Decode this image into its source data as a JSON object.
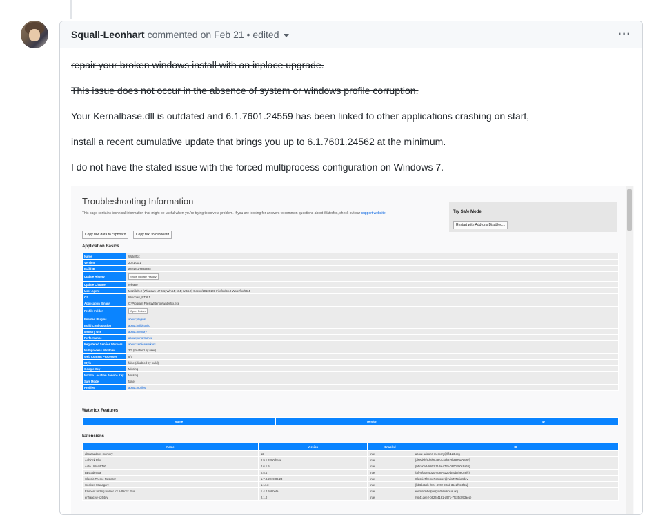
{
  "comment": {
    "author": "Squall-Leonhart",
    "action": "commented on",
    "date": "Feb 21",
    "separator": "•",
    "edited": "edited",
    "more": "···",
    "paragraphs": [
      {
        "text": "repair your broken windows install with an inplace upgrade.",
        "strike": true
      },
      {
        "text": "This issue does not occur in the absence of system or windows profile corruption.",
        "strike": true
      },
      {
        "text": "Your Kernalbase.dll is outdated and 6.1.7601.24559 has been linked to other applications crashing on start,",
        "strike": false
      },
      {
        "text": "install a recent cumulative update that brings you up to 6.1.7601.24562 at the minimum.",
        "strike": false
      },
      {
        "text": "I do not have the stated issue with the forced multiprocess configuration on Windows 7.",
        "strike": false
      }
    ]
  },
  "screenshot": {
    "title": "Troubleshooting Information",
    "desc": "This page contains technical information that might be useful when you're trying to solve a problem. If you are looking for answers to common questions about Waterfox, check out our",
    "desc_link": "support website.",
    "copy_raw": "Copy raw data to clipboard",
    "copy_text": "Copy text to clipboard",
    "safe_mode_title": "Try Safe Mode",
    "safe_mode_button": "Restart with Add-ons Disabled...",
    "app_basics_title": "Application Basics",
    "app_basics": [
      {
        "k": "Name",
        "v": "Waterfox"
      },
      {
        "k": "Version",
        "v": "2021.01.1"
      },
      {
        "k": "Build ID",
        "v": "20210127092903"
      },
      {
        "k": "Update History",
        "btn": "Show Update History"
      },
      {
        "k": "Update Channel",
        "v": "release"
      },
      {
        "k": "User Agent",
        "v": "Mozilla/5.0 (Windows NT 6.1; Win64; x64; rv:56.0) Gecko/20100101 Firefox/56.0 Waterfox/56.4"
      },
      {
        "k": "OS",
        "v": "Windows_NT 6.1"
      },
      {
        "k": "Application Binary",
        "v": "C:\\Program Files\\Waterfox\\waterfox.exe"
      },
      {
        "k": "Profile Folder",
        "btn": "Open Folder"
      },
      {
        "k": "Enabled Plugins",
        "link": "about:plugins"
      },
      {
        "k": "Build Configuration",
        "link": "about:buildconfig"
      },
      {
        "k": "Memory Use",
        "link": "about:memory"
      },
      {
        "k": "Performance",
        "link": "about:performance"
      },
      {
        "k": "Registered Service Workers",
        "link": "about:serviceworkers"
      },
      {
        "k": "Multiprocess Windows",
        "v": "2/2 (Enabled by user)"
      },
      {
        "k": "Web Content Processes",
        "v": "8/7"
      },
      {
        "k": "Stylo",
        "v": "false (disabled by build)"
      },
      {
        "k": "Google Key",
        "v": "Missing"
      },
      {
        "k": "Mozilla Location Service Key",
        "v": "Missing"
      },
      {
        "k": "Safe Mode",
        "v": "false"
      },
      {
        "k": "Profiles",
        "link": "about:profiles"
      }
    ],
    "features_title": "Waterfox Features",
    "features_cols": [
      "Name",
      "Version",
      "ID"
    ],
    "extensions_title": "Extensions",
    "extensions_cols": [
      "Name",
      "Version",
      "Enabled",
      "ID"
    ],
    "extensions": [
      [
        "aboutaddons-memory",
        "12",
        "true",
        "about-addons-memory@lfk123.org"
      ],
      [
        "Adblock Plus",
        "2.9.1.4200-beta",
        "true",
        "{d10d0bf8-f5b5-c8b4-a8b2-2b9879e08c5d}"
      ],
      [
        "Auto Unload Tab",
        "0.6.1.5",
        "true",
        "{b5cdcad-966d-11da-a72b-0800200c9a66}"
      ],
      [
        "BBCodeXtra",
        "0.5.4",
        "true",
        "{af79f008-4b20-4cae-822b-b5db7be028fc}"
      ],
      [
        "Classic Theme Restorer",
        "1.7.8.2019.06.23",
        "true",
        "ClassicThemeRestorer@ArisT2Noia4dev"
      ],
      [
        "Cookies Manager+",
        "1.14.3",
        "true",
        "{bb6bc1bb-f824-4702-90cd-35e2f9c3f2a}"
      ],
      [
        "Element Hiding Helper for Adblock Plus",
        "1.4.0.558beta",
        "true",
        "elemhidehelper@adblockplus.org"
      ],
      [
        "enhanced-h264ify",
        "2.1.0",
        "true",
        "{9a41dee2-b924-4161-a971-7fb35c053aea}"
      ]
    ]
  }
}
